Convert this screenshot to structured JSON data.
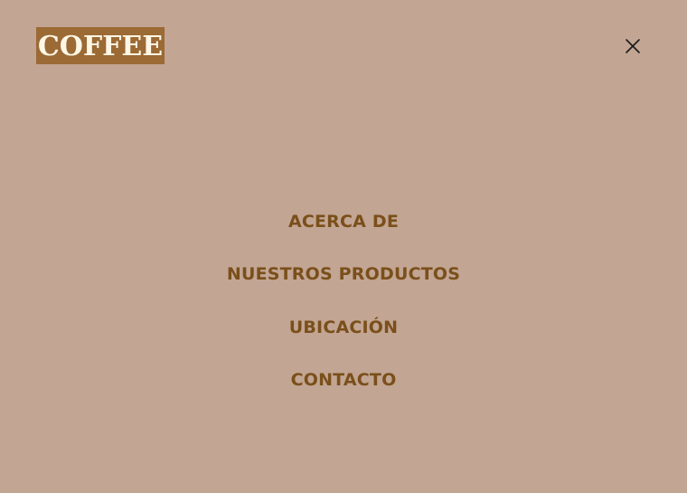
{
  "header": {
    "logo_text": "COFFEE"
  },
  "nav": {
    "items": [
      {
        "label": "ACERCA DE"
      },
      {
        "label": "NUESTROS PRODUCTOS"
      },
      {
        "label": "UBICACIÓN"
      },
      {
        "label": "CONTACTO"
      }
    ]
  },
  "icons": {
    "close": "close-icon"
  },
  "colors": {
    "background": "#c2a593",
    "logo_background": "#9b6a35",
    "logo_text": "#fff7e6",
    "menu_text": "#7a4f1a",
    "close_icon": "#1a1a1a"
  }
}
